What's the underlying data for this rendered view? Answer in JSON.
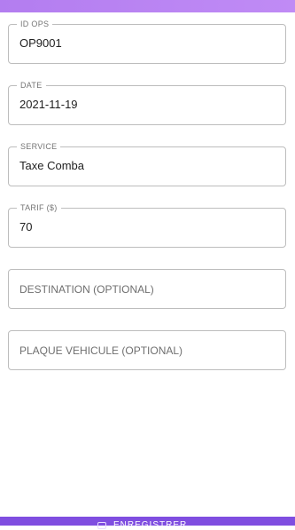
{
  "colors": {
    "accent_top": "#c08bf5",
    "accent_bottom": "#7f4ee0",
    "border": "#bdbdbd"
  },
  "form": {
    "id_ops": {
      "label": "ID OPS",
      "value": "OP9001"
    },
    "date": {
      "label": "DATE",
      "value": "2021-11-19"
    },
    "service": {
      "label": "SERVICE",
      "value": "Taxe Comba"
    },
    "tarif": {
      "label": "TARIF ($)",
      "value": "70"
    },
    "destination": {
      "placeholder": "DESTINATION (OPTIONAL)"
    },
    "plaque": {
      "placeholder": "PLAQUE VEHICULE (OPTIONAL)"
    }
  },
  "bottom_button": {
    "icon": "save-icon",
    "label": "ENREGISTRER"
  }
}
